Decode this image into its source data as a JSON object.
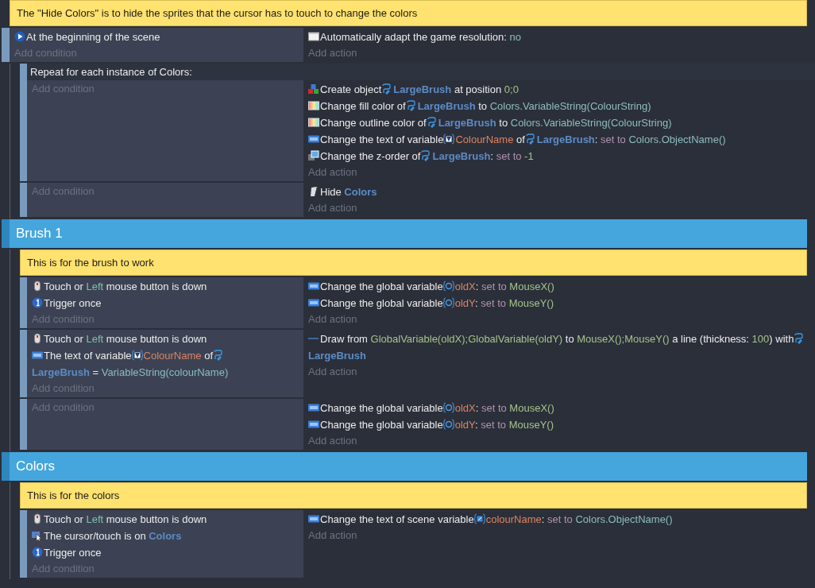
{
  "events": [
    {
      "kind": "comment",
      "text": "The \"Hide Colors\" is to hide the sprites that the cursor has to touch to change the colors"
    },
    {
      "kind": "standard",
      "conditions": [
        {
          "kind": "scene-start",
          "parts": [
            {
              "kind": "text",
              "text": "At the beginning of the scene"
            }
          ]
        }
      ],
      "add_condition": "Add condition",
      "actions": [
        {
          "kind": "window",
          "parts": [
            {
              "kind": "text",
              "text": "Automatically adapt the game resolution: "
            },
            {
              "kind": "expr",
              "text": "no"
            }
          ]
        }
      ],
      "add_action": "Add action",
      "children": [
        {
          "kind": "repeat",
          "header": "Repeat for each instance of Colors:",
          "add_condition": "Add condition",
          "actions": [
            {
              "kind": "create",
              "parts": [
                {
                  "kind": "text",
                  "text": "Create object "
                },
                {
                  "kind": "object",
                  "text": "LargeBrush"
                },
                {
                  "kind": "text",
                  "text": " at position "
                },
                {
                  "kind": "num",
                  "text": "0;0"
                }
              ]
            },
            {
              "kind": "color",
              "parts": [
                {
                  "kind": "text",
                  "text": "Change fill color of "
                },
                {
                  "kind": "object",
                  "text": "LargeBrush"
                },
                {
                  "kind": "text",
                  "text": " to "
                },
                {
                  "kind": "expr",
                  "text": "Colors.VariableString(ColourString)"
                }
              ]
            },
            {
              "kind": "color",
              "parts": [
                {
                  "kind": "text",
                  "text": "Change outline color of "
                },
                {
                  "kind": "object",
                  "text": "LargeBrush"
                },
                {
                  "kind": "text",
                  "text": " to "
                },
                {
                  "kind": "expr",
                  "text": "Colors.VariableString(ColourString)"
                }
              ]
            },
            {
              "kind": "variable",
              "parts": [
                {
                  "kind": "text",
                  "text": "Change the text of variable "
                },
                {
                  "kind": "objvar",
                  "text": "ColourName"
                },
                {
                  "kind": "text",
                  "text": " of "
                },
                {
                  "kind": "object",
                  "text": "LargeBrush"
                },
                {
                  "kind": "text",
                  "text": ": "
                },
                {
                  "kind": "op",
                  "text": "set to "
                },
                {
                  "kind": "expr",
                  "text": "Colors.ObjectName()"
                }
              ]
            },
            {
              "kind": "zorder",
              "parts": [
                {
                  "kind": "text",
                  "text": "Change the z-order of "
                },
                {
                  "kind": "object",
                  "text": "LargeBrush"
                },
                {
                  "kind": "text",
                  "text": ": "
                },
                {
                  "kind": "op",
                  "text": "set to "
                },
                {
                  "kind": "num",
                  "text": "-1"
                }
              ]
            }
          ],
          "add_action": "Add action"
        },
        {
          "kind": "standard",
          "add_condition": "Add condition",
          "actions": [
            {
              "kind": "hide",
              "parts": [
                {
                  "kind": "text",
                  "text": " Hide "
                },
                {
                  "kind": "name",
                  "text": "Colors"
                }
              ]
            }
          ],
          "add_action": "Add action"
        }
      ]
    },
    {
      "kind": "group",
      "title": "Brush 1",
      "children": [
        {
          "kind": "comment",
          "text": "This is for the brush to work"
        },
        {
          "kind": "standard",
          "conditions": [
            {
              "kind": "mouse",
              "parts": [
                {
                  "kind": "text",
                  "text": " Touch or "
                },
                {
                  "kind": "key",
                  "text": "Left"
                },
                {
                  "kind": "text",
                  "text": " mouse button is down"
                }
              ]
            },
            {
              "kind": "trigger",
              "parts": [
                {
                  "kind": "text",
                  "text": "Trigger once"
                }
              ]
            }
          ],
          "add_condition": "Add condition",
          "actions": [
            {
              "kind": "variable",
              "parts": [
                {
                  "kind": "text",
                  "text": "Change the global variable "
                },
                {
                  "kind": "globalvar",
                  "text": "oldX"
                },
                {
                  "kind": "text",
                  "text": ": "
                },
                {
                  "kind": "op",
                  "text": "set to "
                },
                {
                  "kind": "num",
                  "text": "MouseX()"
                }
              ]
            },
            {
              "kind": "variable",
              "parts": [
                {
                  "kind": "text",
                  "text": "Change the global variable "
                },
                {
                  "kind": "globalvar",
                  "text": "oldY"
                },
                {
                  "kind": "text",
                  "text": ": "
                },
                {
                  "kind": "op",
                  "text": "set to "
                },
                {
                  "kind": "num",
                  "text": "MouseY()"
                }
              ]
            }
          ],
          "add_action": "Add action"
        },
        {
          "kind": "standard",
          "conditions": [
            {
              "kind": "mouse",
              "parts": [
                {
                  "kind": "text",
                  "text": " Touch or "
                },
                {
                  "kind": "key",
                  "text": "Left"
                },
                {
                  "kind": "text",
                  "text": " mouse button is down"
                }
              ]
            },
            {
              "kind": "variable",
              "parts": [
                {
                  "kind": "text",
                  "text": "The text of variable "
                },
                {
                  "kind": "objvar",
                  "text": "ColourName"
                },
                {
                  "kind": "text",
                  "text": " of "
                },
                {
                  "kind": "object",
                  "text": "LargeBrush"
                },
                {
                  "kind": "text",
                  "text": " = "
                },
                {
                  "kind": "expr",
                  "text": "VariableString(colourName)"
                }
              ]
            }
          ],
          "add_condition": "Add condition",
          "actions": [
            {
              "kind": "line",
              "parts": [
                {
                  "kind": "text",
                  "text": " Draw from "
                },
                {
                  "kind": "num",
                  "text": "GlobalVariable(oldX);GlobalVariable(oldY)"
                },
                {
                  "kind": "text",
                  "text": " to "
                },
                {
                  "kind": "num",
                  "text": "MouseX();MouseY()"
                },
                {
                  "kind": "text",
                  "text": " a line (thickness: "
                },
                {
                  "kind": "num",
                  "text": "100"
                },
                {
                  "kind": "text",
                  "text": ") with "
                },
                {
                  "kind": "object",
                  "text": "LargeBrush"
                }
              ]
            }
          ],
          "add_action": "Add action"
        },
        {
          "kind": "standard",
          "add_condition": "Add condition",
          "actions": [
            {
              "kind": "variable",
              "parts": [
                {
                  "kind": "text",
                  "text": "Change the global variable "
                },
                {
                  "kind": "globalvar",
                  "text": "oldX"
                },
                {
                  "kind": "text",
                  "text": ": "
                },
                {
                  "kind": "op",
                  "text": "set to "
                },
                {
                  "kind": "num",
                  "text": "MouseX()"
                }
              ]
            },
            {
              "kind": "variable",
              "parts": [
                {
                  "kind": "text",
                  "text": "Change the global variable "
                },
                {
                  "kind": "globalvar",
                  "text": "oldY"
                },
                {
                  "kind": "text",
                  "text": ": "
                },
                {
                  "kind": "op",
                  "text": "set to "
                },
                {
                  "kind": "num",
                  "text": "MouseY()"
                }
              ]
            }
          ],
          "add_action": "Add action"
        }
      ]
    },
    {
      "kind": "group",
      "title": "Colors",
      "children": [
        {
          "kind": "comment",
          "text": "This is for the colors"
        },
        {
          "kind": "standard",
          "conditions": [
            {
              "kind": "mouse",
              "parts": [
                {
                  "kind": "text",
                  "text": " Touch or "
                },
                {
                  "kind": "key",
                  "text": "Left"
                },
                {
                  "kind": "text",
                  "text": " mouse button is down"
                }
              ]
            },
            {
              "kind": "cursor",
              "parts": [
                {
                  "kind": "text",
                  "text": "The cursor/touch is on "
                },
                {
                  "kind": "name",
                  "text": "Colors"
                }
              ]
            },
            {
              "kind": "trigger",
              "parts": [
                {
                  "kind": "text",
                  "text": "Trigger once"
                }
              ]
            }
          ],
          "add_condition": "Add condition",
          "actions": [
            {
              "kind": "variable",
              "parts": [
                {
                  "kind": "text",
                  "text": "Change the text of scene variable "
                },
                {
                  "kind": "scenevar",
                  "text": "colourName"
                },
                {
                  "kind": "text",
                  "text": ": "
                },
                {
                  "kind": "op",
                  "text": "set to "
                },
                {
                  "kind": "expr",
                  "text": "Colors.ObjectName()"
                }
              ]
            }
          ],
          "add_action": "Add action"
        }
      ]
    }
  ]
}
